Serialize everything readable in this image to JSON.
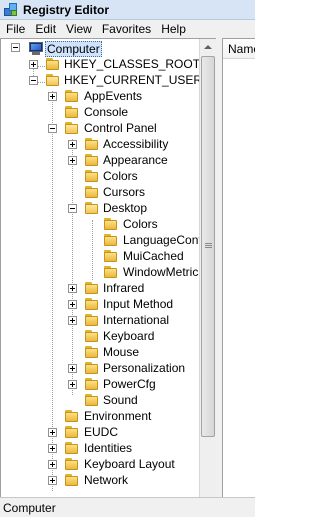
{
  "window": {
    "title": "Registry Editor"
  },
  "menu": [
    "File",
    "Edit",
    "View",
    "Favorites",
    "Help"
  ],
  "tree": {
    "root": "Computer",
    "hives": [
      {
        "label": "HKEY_CLASSES_ROOT",
        "state": "collapsed"
      },
      {
        "label": "HKEY_CURRENT_USER",
        "state": "expanded"
      }
    ],
    "hkcu_children": [
      {
        "label": "AppEvents",
        "state": "collapsed"
      },
      {
        "label": "Console",
        "state": "none"
      },
      {
        "label": "Control Panel",
        "state": "expanded"
      },
      {
        "label": "Environment",
        "state": "none"
      },
      {
        "label": "EUDC",
        "state": "collapsed"
      },
      {
        "label": "Identities",
        "state": "collapsed"
      },
      {
        "label": "Keyboard Layout",
        "state": "collapsed"
      },
      {
        "label": "Network",
        "state": "collapsed"
      }
    ],
    "control_panel_children": [
      {
        "label": "Accessibility",
        "state": "collapsed"
      },
      {
        "label": "Appearance",
        "state": "collapsed"
      },
      {
        "label": "Colors",
        "state": "none"
      },
      {
        "label": "Cursors",
        "state": "none"
      },
      {
        "label": "Desktop",
        "state": "expanded"
      },
      {
        "label": "Infrared",
        "state": "collapsed"
      },
      {
        "label": "Input Method",
        "state": "collapsed"
      },
      {
        "label": "International",
        "state": "collapsed"
      },
      {
        "label": "Keyboard",
        "state": "none"
      },
      {
        "label": "Mouse",
        "state": "none"
      },
      {
        "label": "Personalization",
        "state": "collapsed"
      },
      {
        "label": "PowerCfg",
        "state": "collapsed"
      },
      {
        "label": "Sound",
        "state": "none"
      }
    ],
    "desktop_children": [
      {
        "label": "Colors"
      },
      {
        "label": "LanguageConfig"
      },
      {
        "label": "MuiCached"
      },
      {
        "label": "WindowMetrics"
      }
    ]
  },
  "list": {
    "column_name": "Name"
  },
  "status": {
    "path": "Computer"
  }
}
